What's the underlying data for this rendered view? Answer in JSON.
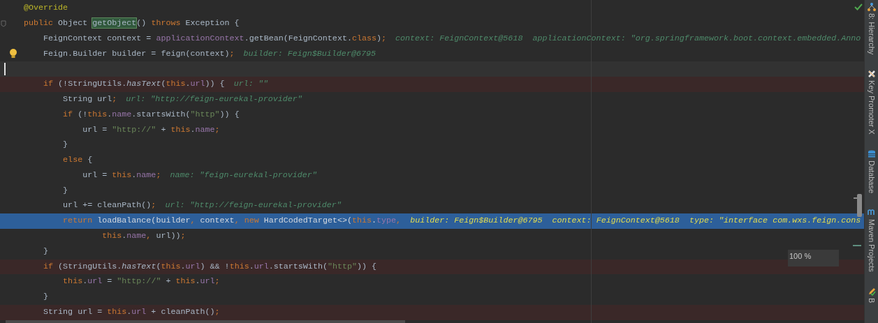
{
  "editor": {
    "lines": [
      {
        "kind": "plain",
        "tokens": [
          {
            "kind": "annotation",
            "text": "@Override"
          }
        ]
      },
      {
        "kind": "plain",
        "gutter": {
          "kind": "fold"
        },
        "tokens": [
          {
            "kind": "keyword",
            "text": "public"
          },
          {
            "kind": "plain",
            "text": " Object "
          },
          {
            "kind": "method",
            "text": "getObject"
          },
          {
            "kind": "plain",
            "text": "() "
          },
          {
            "kind": "keyword",
            "text": "throws"
          },
          {
            "kind": "plain",
            "text": " Exception {"
          }
        ]
      },
      {
        "kind": "plain",
        "tokens": [
          {
            "kind": "plain",
            "text": "    FeignContext context = "
          },
          {
            "kind": "field",
            "text": "applicationContext"
          },
          {
            "kind": "plain",
            "text": ".getBean(FeignContext."
          },
          {
            "kind": "keyword",
            "text": "class"
          },
          {
            "kind": "plain",
            "text": ")"
          },
          {
            "kind": "keyword",
            "text": ";"
          }
        ],
        "debug": "context: FeignContext@5618  applicationContext: \"org.springframework.boot.context.embedded.Anno"
      },
      {
        "kind": "plain",
        "gutter": {
          "kind": "bulb"
        },
        "tokens": [
          {
            "kind": "plain",
            "text": "    Feign.Builder builder = feign(context)"
          },
          {
            "kind": "keyword",
            "text": ";"
          }
        ],
        "debug": "builder: Feign$Builder@6795"
      },
      {
        "kind": "current",
        "gutter": {
          "kind": "caret"
        }
      },
      {
        "kind": "breakpoint",
        "tokens": [
          {
            "kind": "keyword",
            "text": "    if"
          },
          {
            "kind": "plain",
            "text": " (!StringUtils."
          },
          {
            "kind": "static",
            "text": "hasText"
          },
          {
            "kind": "plain",
            "text": "("
          },
          {
            "kind": "keyword",
            "text": "this"
          },
          {
            "kind": "plain",
            "text": "."
          },
          {
            "kind": "field",
            "text": "url"
          },
          {
            "kind": "plain",
            "text": ")) {"
          }
        ],
        "debug": "url: \"\""
      },
      {
        "kind": "plain",
        "tokens": [
          {
            "kind": "plain",
            "text": "        String url"
          },
          {
            "kind": "keyword",
            "text": ";"
          }
        ],
        "debug": "url: \"http://feign-eurekal-provider\""
      },
      {
        "kind": "plain",
        "tokens": [
          {
            "kind": "keyword",
            "text": "        if"
          },
          {
            "kind": "plain",
            "text": " (!"
          },
          {
            "kind": "keyword",
            "text": "this"
          },
          {
            "kind": "plain",
            "text": "."
          },
          {
            "kind": "field",
            "text": "name"
          },
          {
            "kind": "plain",
            "text": ".startsWith("
          },
          {
            "kind": "string",
            "text": "\"http\""
          },
          {
            "kind": "plain",
            "text": ")) {"
          }
        ]
      },
      {
        "kind": "plain",
        "tokens": [
          {
            "kind": "plain",
            "text": "            url = "
          },
          {
            "kind": "string",
            "text": "\"http://\""
          },
          {
            "kind": "plain",
            "text": " + "
          },
          {
            "kind": "keyword",
            "text": "this"
          },
          {
            "kind": "plain",
            "text": "."
          },
          {
            "kind": "field",
            "text": "name"
          },
          {
            "kind": "keyword",
            "text": ";"
          }
        ]
      },
      {
        "kind": "plain",
        "tokens": [
          {
            "kind": "plain",
            "text": "        }"
          }
        ]
      },
      {
        "kind": "plain",
        "tokens": [
          {
            "kind": "keyword",
            "text": "        else"
          },
          {
            "kind": "plain",
            "text": " {"
          }
        ]
      },
      {
        "kind": "plain",
        "tokens": [
          {
            "kind": "plain",
            "text": "            url = "
          },
          {
            "kind": "keyword",
            "text": "this"
          },
          {
            "kind": "plain",
            "text": "."
          },
          {
            "kind": "field",
            "text": "name"
          },
          {
            "kind": "keyword",
            "text": ";"
          }
        ],
        "debug": "name: \"feign-eurekal-provider\""
      },
      {
        "kind": "plain",
        "tokens": [
          {
            "kind": "plain",
            "text": "        }"
          }
        ]
      },
      {
        "kind": "plain",
        "tokens": [
          {
            "kind": "plain",
            "text": "        url += cleanPath()"
          },
          {
            "kind": "keyword",
            "text": ";"
          }
        ],
        "debug": "url: \"http://feign-eurekal-provider\""
      },
      {
        "kind": "selected",
        "tokens": [
          {
            "kind": "keyword",
            "text": "        return"
          },
          {
            "kind": "plain",
            "text": " loadBalance(builder"
          },
          {
            "kind": "keyword",
            "text": ", "
          },
          {
            "kind": "plain",
            "text": "context"
          },
          {
            "kind": "keyword",
            "text": ", new"
          },
          {
            "kind": "plain",
            "text": " HardCodedTarget<>("
          },
          {
            "kind": "keyword",
            "text": "this"
          },
          {
            "kind": "plain",
            "text": "."
          },
          {
            "kind": "field",
            "text": "type"
          },
          {
            "kind": "keyword",
            "text": ","
          }
        ],
        "debug": "builder: Feign$Builder@6795  context: FeignContext@5618  type: \"interface com.wxs.feign.cons"
      },
      {
        "kind": "plain",
        "tokens": [
          {
            "kind": "keyword",
            "text": "                this"
          },
          {
            "kind": "plain",
            "text": "."
          },
          {
            "kind": "field",
            "text": "name"
          },
          {
            "kind": "keyword",
            "text": ", "
          },
          {
            "kind": "plain",
            "text": "url))"
          },
          {
            "kind": "keyword",
            "text": ";"
          }
        ]
      },
      {
        "kind": "plain",
        "tokens": [
          {
            "kind": "plain",
            "text": "    }"
          }
        ]
      },
      {
        "kind": "breakpoint",
        "tokens": [
          {
            "kind": "keyword",
            "text": "    if"
          },
          {
            "kind": "plain",
            "text": " (StringUtils."
          },
          {
            "kind": "static",
            "text": "hasText"
          },
          {
            "kind": "plain",
            "text": "("
          },
          {
            "kind": "keyword",
            "text": "this"
          },
          {
            "kind": "plain",
            "text": "."
          },
          {
            "kind": "field",
            "text": "url"
          },
          {
            "kind": "plain",
            "text": ") && !"
          },
          {
            "kind": "keyword",
            "text": "this"
          },
          {
            "kind": "plain",
            "text": "."
          },
          {
            "kind": "field",
            "text": "url"
          },
          {
            "kind": "plain",
            "text": ".startsWith("
          },
          {
            "kind": "string",
            "text": "\"http\""
          },
          {
            "kind": "plain",
            "text": ")) {"
          }
        ]
      },
      {
        "kind": "plain",
        "tokens": [
          {
            "kind": "keyword",
            "text": "        this"
          },
          {
            "kind": "plain",
            "text": "."
          },
          {
            "kind": "field",
            "text": "url"
          },
          {
            "kind": "plain",
            "text": " = "
          },
          {
            "kind": "string",
            "text": "\"http://\""
          },
          {
            "kind": "plain",
            "text": " + "
          },
          {
            "kind": "keyword",
            "text": "this"
          },
          {
            "kind": "plain",
            "text": "."
          },
          {
            "kind": "field",
            "text": "url"
          },
          {
            "kind": "keyword",
            "text": ";"
          }
        ]
      },
      {
        "kind": "plain",
        "tokens": [
          {
            "kind": "plain",
            "text": "    }"
          }
        ]
      },
      {
        "kind": "breakpoint",
        "tokens": [
          {
            "kind": "plain",
            "text": "    String url = "
          },
          {
            "kind": "keyword",
            "text": "this"
          },
          {
            "kind": "plain",
            "text": "."
          },
          {
            "kind": "field",
            "text": "url"
          },
          {
            "kind": "plain",
            "text": " + cleanPath()"
          },
          {
            "kind": "keyword",
            "text": ";"
          }
        ]
      }
    ],
    "zoom_popup": "100 %"
  },
  "tool_strip": [
    {
      "label": "8: Hierarchy"
    },
    {
      "label": "Key Promoter X"
    },
    {
      "label": "Database"
    },
    {
      "label": "Maven Projects"
    },
    {
      "label": "B"
    }
  ]
}
